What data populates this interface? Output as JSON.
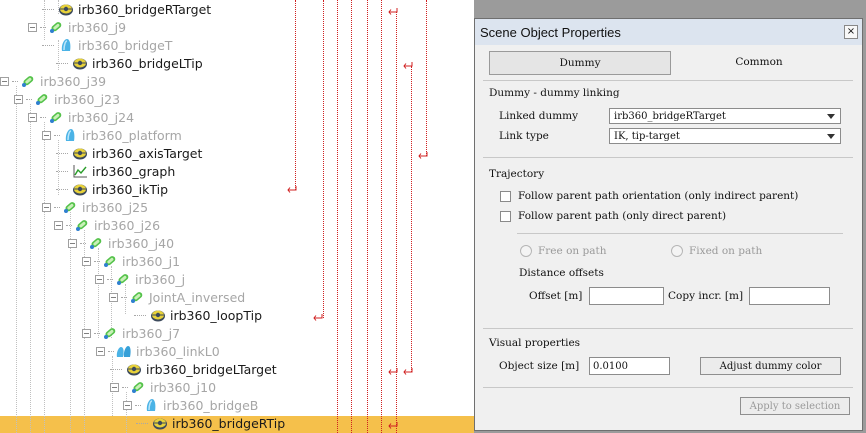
{
  "tree": {
    "items": [
      {
        "label": "irb360_bridgeRTarget",
        "style": "dark",
        "icon": "dummy-target-icon"
      },
      {
        "label": "irb360_j9",
        "style": "grey",
        "icon": "joint-icon"
      },
      {
        "label": "irb360_bridgeT",
        "style": "grey",
        "icon": "shape-icon"
      },
      {
        "label": "irb360_bridgeLTip",
        "style": "dark",
        "icon": "dummy-target-icon"
      },
      {
        "label": "irb360_j39",
        "style": "grey",
        "icon": "joint-icon"
      },
      {
        "label": "irb360_j23",
        "style": "grey",
        "icon": "joint-icon"
      },
      {
        "label": "irb360_j24",
        "style": "grey",
        "icon": "joint-icon"
      },
      {
        "label": "irb360_platform",
        "style": "grey",
        "icon": "shape-icon"
      },
      {
        "label": "irb360_axisTarget",
        "style": "dark",
        "icon": "dummy-target-icon"
      },
      {
        "label": "irb360_graph",
        "style": "dark",
        "icon": "graph-icon"
      },
      {
        "label": "irb360_ikTip",
        "style": "dark",
        "icon": "dummy-target-icon"
      },
      {
        "label": "irb360_j25",
        "style": "grey",
        "icon": "joint-icon"
      },
      {
        "label": "irb360_j26",
        "style": "grey",
        "icon": "joint-icon"
      },
      {
        "label": "irb360_j40",
        "style": "grey",
        "icon": "joint-icon"
      },
      {
        "label": "irb360_j1",
        "style": "grey",
        "icon": "joint-icon"
      },
      {
        "label": "irb360_j",
        "style": "grey",
        "icon": "joint-icon"
      },
      {
        "label": "JointA_inversed",
        "style": "grey",
        "icon": "joint-icon"
      },
      {
        "label": "irb360_loopTip",
        "style": "dark",
        "icon": "dummy-target-icon"
      },
      {
        "label": "irb360_j7",
        "style": "grey",
        "icon": "joint-icon"
      },
      {
        "label": "irb360_linkL0",
        "style": "grey",
        "icon": "shape-group-icon"
      },
      {
        "label": "irb360_bridgeLTarget",
        "style": "dark",
        "icon": "dummy-target-icon"
      },
      {
        "label": "irb360_j10",
        "style": "grey",
        "icon": "joint-icon"
      },
      {
        "label": "irb360_bridgeB",
        "style": "grey",
        "icon": "shape-icon"
      },
      {
        "label": "irb360_bridgeRTip",
        "style": "dark",
        "icon": "dummy-target-icon",
        "selected": true
      }
    ]
  },
  "dialog": {
    "title": "Scene Object Properties",
    "tabs": [
      {
        "label": "Dummy",
        "active": true
      },
      {
        "label": "Common",
        "active": false
      }
    ],
    "linking": {
      "section_title": "Dummy - dummy linking",
      "linked_label": "Linked dummy",
      "linked_value": "irb360_bridgeRTarget",
      "type_label": "Link type",
      "type_value": "IK, tip-target"
    },
    "trajectory": {
      "section_title": "Trajectory",
      "follow_orientation": "Follow parent path orientation (only indirect parent)",
      "follow_path": "Follow parent path (only direct parent)",
      "free_on_path": "Free on path",
      "fixed_on_path": "Fixed on path",
      "distance_offsets": "Distance offsets",
      "offset_label": "Offset [m]",
      "offset_value": "",
      "copy_incr_label": "Copy incr. [m]",
      "copy_incr_value": ""
    },
    "visual": {
      "section_title": "Visual properties",
      "size_label": "Object size [m]",
      "size_value": "0.0100",
      "adjust_color": "Adjust dummy color"
    },
    "apply_button": "Apply to selection",
    "close_glyph": "×"
  },
  "colors": {
    "selection": "#f5c04b",
    "link_arrows": "#d02020",
    "disabled_text": "#9a9a9a"
  }
}
